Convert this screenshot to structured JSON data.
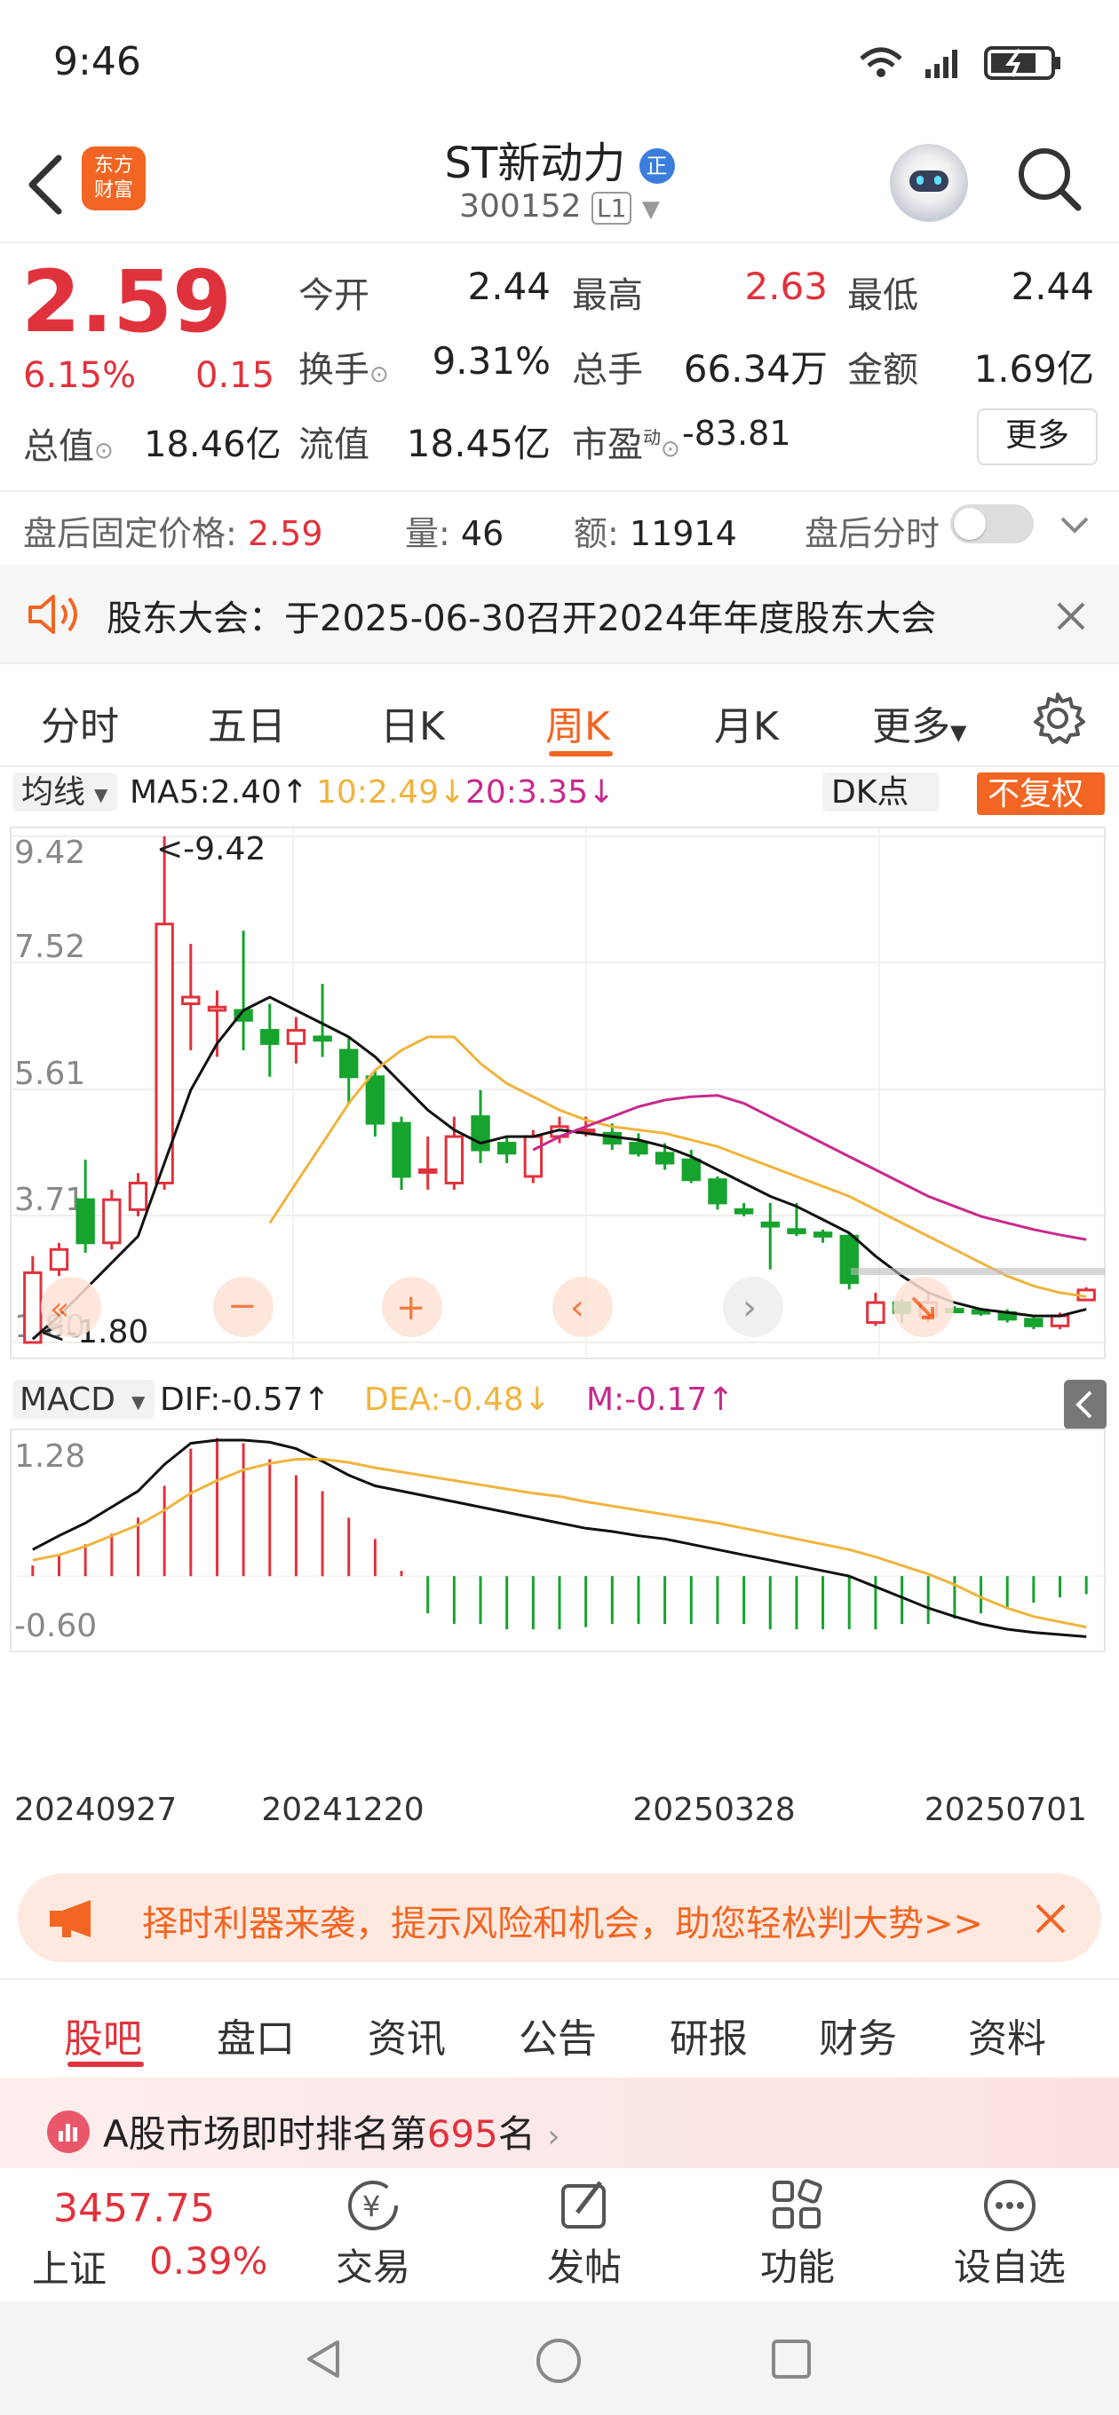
{
  "status_bar": {
    "time": "9:46"
  },
  "header": {
    "logo_text": "东方财富",
    "stock_name": "ST新动力",
    "badge": "正",
    "stock_code": "300152",
    "level": "L1"
  },
  "quote": {
    "price": "2.59",
    "change_pct": "6.15%",
    "change": "0.15",
    "fields": [
      {
        "label": "今开",
        "value": "2.44",
        "color": "#222222"
      },
      {
        "label": "最高",
        "value": "2.63",
        "color": "#e0323c"
      },
      {
        "label": "最低",
        "value": "2.44",
        "color": "#222222"
      },
      {
        "label": "换手",
        "value": "9.31%",
        "color": "#222222"
      },
      {
        "label": "总手",
        "value": "66.34万",
        "color": "#222222"
      },
      {
        "label": "金额",
        "value": "1.69亿",
        "color": "#222222"
      },
      {
        "label": "总值",
        "value": "18.46亿",
        "color": "#222222"
      },
      {
        "label": "流值",
        "value": "18.45亿",
        "color": "#222222"
      },
      {
        "label": "市盈",
        "value": "-83.81",
        "color": "#222222"
      }
    ],
    "pe_sup": "动",
    "more": "更多"
  },
  "after_hours": {
    "price_label": "盘后固定价格:",
    "price": "2.59",
    "vol_label": "量:",
    "vol": "46",
    "amt_label": "额:",
    "amt": "11914",
    "timeshare_label": "盘后分时"
  },
  "notice": {
    "text": "股东大会：于2025-06-30召开2024年年度股东大会"
  },
  "chart_tabs": [
    "分时",
    "五日",
    "日K",
    "周K",
    "月K",
    "更多"
  ],
  "active_chart_tab": 3,
  "ma_bar": {
    "mode": "均线",
    "ma5": "MA5:2.40↑",
    "ma10": "10:2.49↓",
    "ma20": "20:3.35↓",
    "dk": "DK点",
    "adjust": "不复权"
  },
  "macd_bar": {
    "mode": "MACD",
    "dif": "DIF:-0.57↑",
    "dea": "DEA:-0.48↓",
    "m": "M:-0.17↑"
  },
  "colors": {
    "up": "#e0323c",
    "down": "#16a32e",
    "accent": "#f26522",
    "ma5": "#111111",
    "ma10": "#f0b43c",
    "ma20": "#c8288c"
  },
  "chart_data": [
    {
      "type": "candlestick",
      "title": "周K",
      "y_ticks": [
        "9.42",
        "7.52",
        "5.61",
        "3.71",
        "1.80"
      ],
      "ylim": [
        1.8,
        9.42
      ],
      "max_marker": "<-9.42",
      "min_marker": "<-1.80",
      "candles": [
        {
          "o": 1.8,
          "c": 2.85,
          "h": 3.1,
          "l": 1.8
        },
        {
          "o": 2.9,
          "c": 3.2,
          "h": 3.3,
          "l": 2.8
        },
        {
          "o": 3.95,
          "c": 3.3,
          "h": 4.55,
          "l": 3.15
        },
        {
          "o": 3.3,
          "c": 3.95,
          "h": 4.1,
          "l": 3.2
        },
        {
          "o": 3.8,
          "c": 4.2,
          "h": 4.35,
          "l": 3.7
        },
        {
          "o": 4.2,
          "c": 8.1,
          "h": 9.42,
          "l": 4.1
        },
        {
          "o": 6.9,
          "c": 7.0,
          "h": 7.8,
          "l": 6.2
        },
        {
          "o": 6.8,
          "c": 6.85,
          "h": 7.1,
          "l": 6.1
        },
        {
          "o": 6.8,
          "c": 6.65,
          "h": 8.0,
          "l": 6.2
        },
        {
          "o": 6.5,
          "c": 6.3,
          "h": 6.9,
          "l": 5.8
        },
        {
          "o": 6.3,
          "c": 6.5,
          "h": 6.7,
          "l": 6.0
        },
        {
          "o": 6.4,
          "c": 6.35,
          "h": 7.2,
          "l": 6.1
        },
        {
          "o": 6.2,
          "c": 5.8,
          "h": 6.4,
          "l": 5.4
        },
        {
          "o": 5.8,
          "c": 5.1,
          "h": 5.9,
          "l": 4.9
        },
        {
          "o": 5.1,
          "c": 4.3,
          "h": 5.2,
          "l": 4.1
        },
        {
          "o": 4.4,
          "c": 4.4,
          "h": 4.9,
          "l": 4.1
        },
        {
          "o": 4.2,
          "c": 4.9,
          "h": 5.2,
          "l": 4.1
        },
        {
          "o": 5.2,
          "c": 4.7,
          "h": 5.6,
          "l": 4.5
        },
        {
          "o": 4.8,
          "c": 4.65,
          "h": 4.9,
          "l": 4.5
        },
        {
          "o": 4.3,
          "c": 4.9,
          "h": 5.0,
          "l": 4.2
        },
        {
          "o": 4.9,
          "c": 5.05,
          "h": 5.2,
          "l": 4.8
        },
        {
          "o": 5.0,
          "c": 5.0,
          "h": 5.2,
          "l": 4.9
        },
        {
          "o": 4.95,
          "c": 4.8,
          "h": 5.1,
          "l": 4.7
        },
        {
          "o": 4.8,
          "c": 4.65,
          "h": 4.95,
          "l": 4.6
        },
        {
          "o": 4.65,
          "c": 4.5,
          "h": 4.8,
          "l": 4.4
        },
        {
          "o": 4.55,
          "c": 4.25,
          "h": 4.7,
          "l": 4.2
        },
        {
          "o": 4.25,
          "c": 3.9,
          "h": 4.3,
          "l": 3.8
        },
        {
          "o": 3.8,
          "c": 3.75,
          "h": 3.9,
          "l": 3.7
        },
        {
          "o": 3.6,
          "c": 3.55,
          "h": 3.9,
          "l": 2.9
        },
        {
          "o": 3.5,
          "c": 3.45,
          "h": 3.9,
          "l": 3.4
        },
        {
          "o": 3.45,
          "c": 3.4,
          "h": 3.5,
          "l": 3.3
        },
        {
          "o": 3.4,
          "c": 2.7,
          "h": 3.45,
          "l": 2.6
        },
        {
          "o": 2.1,
          "c": 2.4,
          "h": 2.55,
          "l": 2.05
        },
        {
          "o": 2.4,
          "c": 2.25,
          "h": 2.45,
          "l": 2.1
        },
        {
          "o": 2.2,
          "c": 2.4,
          "h": 2.55,
          "l": 2.1
        },
        {
          "o": 2.3,
          "c": 2.28,
          "h": 2.35,
          "l": 2.25
        },
        {
          "o": 2.28,
          "c": 2.25,
          "h": 2.32,
          "l": 2.2
        },
        {
          "o": 2.25,
          "c": 2.15,
          "h": 2.3,
          "l": 2.1
        },
        {
          "o": 2.15,
          "c": 2.05,
          "h": 2.2,
          "l": 2.0
        },
        {
          "o": 2.05,
          "c": 2.2,
          "h": 2.25,
          "l": 2.0
        },
        {
          "o": 2.44,
          "c": 2.59,
          "h": 2.63,
          "l": 2.44
        }
      ],
      "series": [
        {
          "name": "MA5",
          "values": [
            1.85,
            2.2,
            2.6,
            3.0,
            3.4,
            4.5,
            5.6,
            6.3,
            6.8,
            7.0,
            6.8,
            6.6,
            6.4,
            6.1,
            5.7,
            5.3,
            5.0,
            4.8,
            4.9,
            4.9,
            5.0,
            4.95,
            4.9,
            4.85,
            4.75,
            4.6,
            4.4,
            4.2,
            4.0,
            3.85,
            3.65,
            3.45,
            3.1,
            2.8,
            2.55,
            2.4,
            2.3,
            2.25,
            2.2,
            2.2,
            2.3
          ]
        },
        {
          "name": "MA10",
          "values": [
            null,
            null,
            null,
            null,
            null,
            null,
            null,
            null,
            null,
            3.6,
            4.2,
            4.8,
            5.4,
            5.9,
            6.2,
            6.4,
            6.4,
            6.0,
            5.7,
            5.5,
            5.3,
            5.15,
            5.05,
            5.0,
            4.95,
            4.85,
            4.75,
            4.6,
            4.45,
            4.3,
            4.15,
            4.0,
            3.8,
            3.6,
            3.4,
            3.2,
            3.0,
            2.8,
            2.65,
            2.55,
            2.49
          ]
        },
        {
          "name": "MA20",
          "values": [
            null,
            null,
            null,
            null,
            null,
            null,
            null,
            null,
            null,
            null,
            null,
            null,
            null,
            null,
            null,
            null,
            null,
            null,
            null,
            4.7,
            4.9,
            5.05,
            5.2,
            5.35,
            5.45,
            5.5,
            5.52,
            5.4,
            5.2,
            5.0,
            4.8,
            4.6,
            4.4,
            4.2,
            4.0,
            3.85,
            3.7,
            3.6,
            3.5,
            3.42,
            3.35
          ]
        }
      ]
    },
    {
      "type": "bar",
      "title": "MACD",
      "y_ticks": [
        "1.28",
        "-0.60"
      ],
      "ylim": [
        -0.6,
        1.28
      ],
      "x_ticks": [
        "20240927",
        "20241220",
        "20250328",
        "20250701"
      ],
      "m_values": [
        0.1,
        0.2,
        0.3,
        0.4,
        0.55,
        0.85,
        1.2,
        1.3,
        1.25,
        1.1,
        0.95,
        0.8,
        0.55,
        0.35,
        0.05,
        -0.35,
        -0.45,
        -0.45,
        -0.5,
        -0.5,
        -0.5,
        -0.48,
        -0.45,
        -0.45,
        -0.45,
        -0.45,
        -0.45,
        -0.45,
        -0.5,
        -0.5,
        -0.5,
        -0.5,
        -0.5,
        -0.45,
        -0.45,
        -0.4,
        -0.35,
        -0.3,
        -0.25,
        -0.2,
        -0.17
      ],
      "series": [
        {
          "name": "DIF",
          "values": [
            0.25,
            0.38,
            0.5,
            0.65,
            0.8,
            1.05,
            1.25,
            1.28,
            1.28,
            1.26,
            1.2,
            1.08,
            0.95,
            0.85,
            0.8,
            0.75,
            0.7,
            0.65,
            0.6,
            0.55,
            0.5,
            0.45,
            0.42,
            0.38,
            0.35,
            0.3,
            0.25,
            0.2,
            0.15,
            0.1,
            0.05,
            0.0,
            -0.1,
            -0.2,
            -0.3,
            -0.38,
            -0.45,
            -0.5,
            -0.53,
            -0.55,
            -0.57
          ]
        },
        {
          "name": "DEA",
          "values": [
            0.15,
            0.2,
            0.28,
            0.38,
            0.48,
            0.62,
            0.78,
            0.9,
            1.0,
            1.06,
            1.1,
            1.1,
            1.07,
            1.02,
            0.98,
            0.94,
            0.9,
            0.86,
            0.82,
            0.78,
            0.75,
            0.7,
            0.66,
            0.62,
            0.58,
            0.54,
            0.5,
            0.45,
            0.4,
            0.35,
            0.3,
            0.25,
            0.18,
            0.1,
            0.02,
            -0.08,
            -0.2,
            -0.3,
            -0.38,
            -0.43,
            -0.48
          ]
        }
      ]
    }
  ],
  "banner": {
    "text": "择时利器来袭，提示风险和机会，助您轻松判大势>>"
  },
  "bottom_tabs": [
    "股吧",
    "盘口",
    "资讯",
    "公告",
    "研报",
    "财务",
    "资料"
  ],
  "active_bottom_tab": 0,
  "rank": {
    "prefix": "A股市场即时排名第",
    "rank": "695",
    "suffix": "名"
  },
  "index": {
    "value": "3457.75",
    "name": "上证",
    "pct": "0.39%"
  },
  "bottom_nav": [
    {
      "label": "交易",
      "icon": "yen-exchange-icon"
    },
    {
      "label": "发帖",
      "icon": "edit-icon"
    },
    {
      "label": "功能",
      "icon": "grid-icon"
    },
    {
      "label": "设自选",
      "icon": "more-dots-icon"
    }
  ]
}
